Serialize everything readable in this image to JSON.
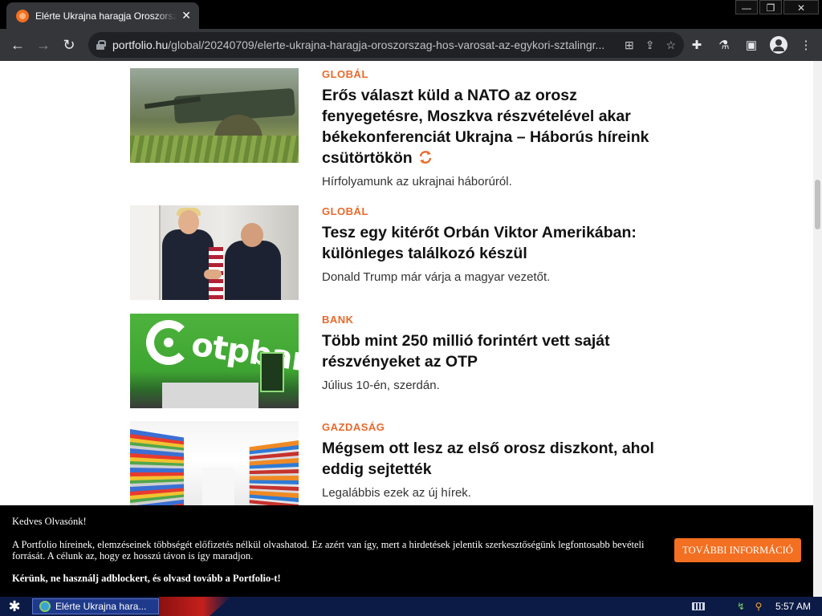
{
  "browser": {
    "tab_title": "Elérte Ukrajna haragja Oroszország hős városát",
    "tab_close": "✕",
    "window_controls": {
      "minimize": "—",
      "restore": "❐",
      "close": "✕"
    },
    "url_host": "portfolio.hu",
    "url_path": "/global/20240709/elerte-ukrajna-haragja-oroszorszag-hos-varosat-az-egykori-sztalingr..."
  },
  "articles": [
    {
      "category": "GLOBÁL",
      "headline": "Erős választ küld a NATO az orosz fenyegetésre, Moszkva részvételével akar békekonferenciát Ukrajna – Háborús híreink csütörtökön",
      "lead": "Hírfolyamunk az ukrajnai háborúról.",
      "live_update_icon": "refresh-icon",
      "image": "military-tank-soldiers"
    },
    {
      "category": "GLOBÁL",
      "headline": "Tesz egy kitérőt Orbán Viktor Amerikában: különleges találkozó készül",
      "lead": "Donald Trump már várja a magyar vezetőt.",
      "image": "handshake-meeting"
    },
    {
      "category": "BANK",
      "headline": "Több mint 250 millió forintért vett saját részvényeket az OTP",
      "lead": "Július 10-én, szerdán.",
      "image": "otp-bank-branch",
      "image_text": "otpbank"
    },
    {
      "category": "GAZDASÁG",
      "headline": "Mégsem ott lesz az első orosz diszkont, ahol eddig sejtették",
      "lead": "Legalábbis ezek az új hírek.",
      "image": "supermarket-aisle"
    }
  ],
  "banner": {
    "greeting": "Kedves Olvasónk!",
    "body": "A Portfolio híreinek, elemzéseinek többségét előfizetés nélkül olvashatod. Ez azért van így, mert a hirdetések jelentik szerkesztőségünk legfontosabb bevételi forrását. A célunk az, hogy ez hosszú távon is így maradjon.",
    "strong": "Kérünk, ne használj adblockert, és olvasd tovább a Portfolio-t!",
    "button": "TOVÁBBI INFORMÁCIÓ"
  },
  "taskbar": {
    "task_label": "Elérte Ukrajna hara...",
    "clock": "5:57 AM"
  },
  "colors": {
    "accent": "#f36f21",
    "category": "#e8692c"
  }
}
